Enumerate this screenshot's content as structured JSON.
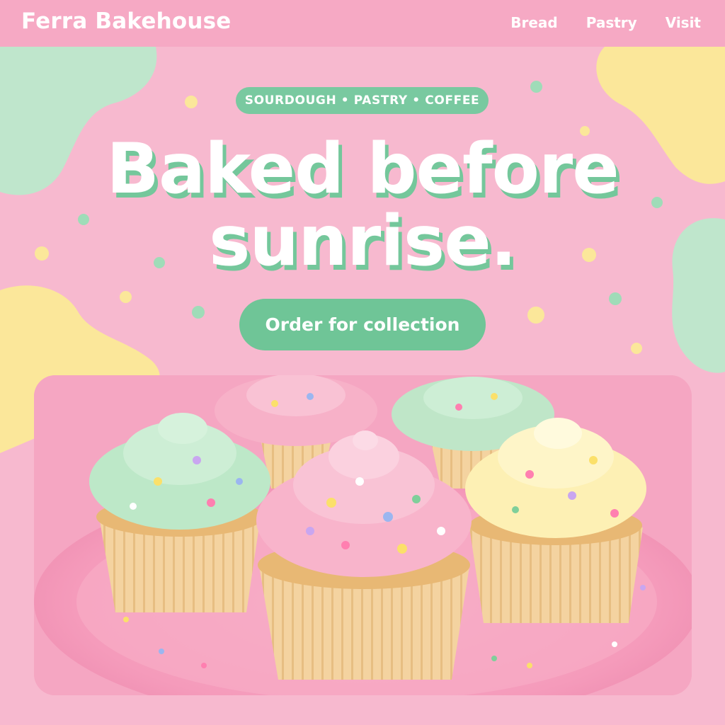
{
  "header": {
    "brand": "Ferra Bakehouse",
    "nav": [
      "Bread",
      "Pastry",
      "Visit"
    ]
  },
  "hero": {
    "tagline": "SOURDOUGH • PASTRY • COFFEE",
    "headline_line1": "Baked before",
    "headline_line2": "sunrise.",
    "cta_label": "Order for collection"
  },
  "image": {
    "subject": "cupcakes with pastel frosting and sprinkles on a pink plate"
  },
  "colors": {
    "background": "#f7b9cf",
    "header": "#f6a9c4",
    "mint": "#79c9a0",
    "yellow": "#fbe79a",
    "pink_frosting": "#f8b4cb",
    "mint_frosting": "#bde8c8",
    "yellow_frosting": "#fdf0b4"
  }
}
